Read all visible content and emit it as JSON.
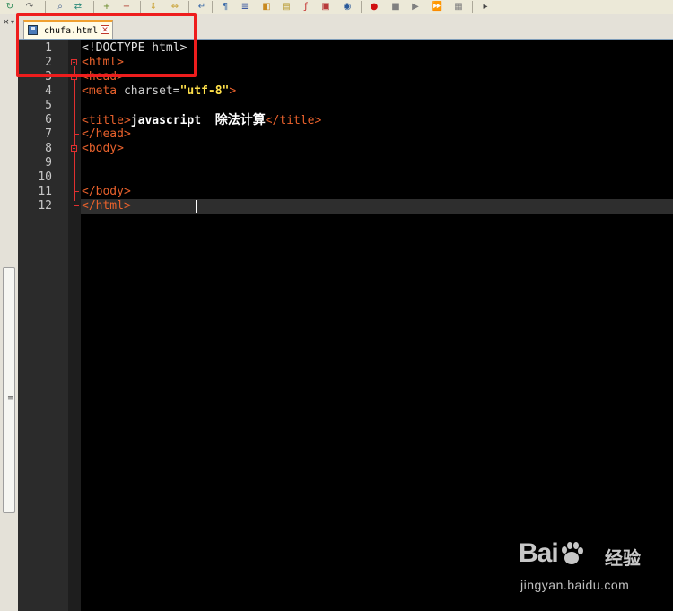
{
  "toolbar": {
    "buttons": [
      {
        "icon": "redo-icon",
        "color": "#2e8b57"
      },
      {
        "icon": "redo-alt-icon",
        "color": "#555555"
      },
      {
        "icon": "find-icon",
        "color": "#3a5a8c"
      },
      {
        "icon": "replace-icon",
        "color": "#2a8a7a"
      },
      {
        "icon": "zoom-in-icon",
        "color": "#6a8a2a"
      },
      {
        "icon": "zoom-out-icon",
        "color": "#b03a2e"
      },
      {
        "icon": "sync-v-icon",
        "color": "#c8a030"
      },
      {
        "icon": "sync-h-icon",
        "color": "#c8a030"
      },
      {
        "icon": "wrap-icon",
        "color": "#3a6aa8"
      },
      {
        "icon": "show-all-chars-icon",
        "color": "#3a6aa8"
      },
      {
        "icon": "indent-guide-icon",
        "color": "#2a4a9a"
      },
      {
        "icon": "udl-icon",
        "color": "#c88a20"
      },
      {
        "icon": "doc-map-icon",
        "color": "#b89a30"
      },
      {
        "icon": "function-list-icon",
        "color": "#c02020"
      },
      {
        "icon": "folder-workspace-icon",
        "color": "#b83a3a"
      },
      {
        "icon": "monitor-icon",
        "color": "#2a5a9a"
      },
      {
        "icon": "record-macro-icon",
        "color": "#d01010"
      },
      {
        "icon": "stop-macro-icon",
        "color": "#808080"
      },
      {
        "icon": "play-macro-icon",
        "color": "#808080"
      },
      {
        "icon": "run-macro-multiple-icon",
        "color": "#2a4ab8"
      },
      {
        "icon": "save-macro-icon",
        "color": "#808080"
      },
      {
        "icon": "run-icon",
        "color": "#444444"
      }
    ]
  },
  "tab": {
    "filename": "chufa.html",
    "close_glyph": "✕",
    "active_color": "#f0a030"
  },
  "left_panel": {
    "close_glyph": "×",
    "arrow_glyph": "▾",
    "grip_glyph": "≡"
  },
  "editor": {
    "background": "#000000",
    "current_line": 12,
    "lines": [
      {
        "n": "1",
        "tokens": [
          {
            "t": "<!DOCTYPE html>",
            "c": "plain"
          }
        ]
      },
      {
        "n": "2",
        "tokens": [
          {
            "t": "<html>",
            "c": "tag"
          }
        ]
      },
      {
        "n": "3",
        "tokens": [
          {
            "t": "<head>",
            "c": "tag"
          }
        ]
      },
      {
        "n": "4",
        "tokens": [
          {
            "t": "<meta ",
            "c": "tag"
          },
          {
            "t": "charset",
            "c": "attr"
          },
          {
            "t": "=",
            "c": "eq"
          },
          {
            "t": "\"utf-8\"",
            "c": "str"
          },
          {
            "t": ">",
            "c": "tag"
          }
        ]
      },
      {
        "n": "5",
        "tokens": []
      },
      {
        "n": "6",
        "tokens": [
          {
            "t": "<title>",
            "c": "tag"
          },
          {
            "t": "javascript  ",
            "c": "text"
          },
          {
            "t": "除法计算",
            "c": "cjk"
          },
          {
            "t": "</title>",
            "c": "tag"
          }
        ]
      },
      {
        "n": "7",
        "tokens": [
          {
            "t": "</head>",
            "c": "tag"
          }
        ]
      },
      {
        "n": "8",
        "tokens": [
          {
            "t": "<body>",
            "c": "tag"
          }
        ]
      },
      {
        "n": "9",
        "tokens": []
      },
      {
        "n": "10",
        "tokens": []
      },
      {
        "n": "11",
        "tokens": [
          {
            "t": "</body>",
            "c": "tag"
          }
        ]
      },
      {
        "n": "12",
        "tokens": [
          {
            "t": "</html>",
            "c": "tag"
          }
        ]
      }
    ]
  },
  "watermark": {
    "logo_text": "Bai  ",
    "logo_suffix": "经验",
    "url": "jingyan.baidu.com"
  }
}
